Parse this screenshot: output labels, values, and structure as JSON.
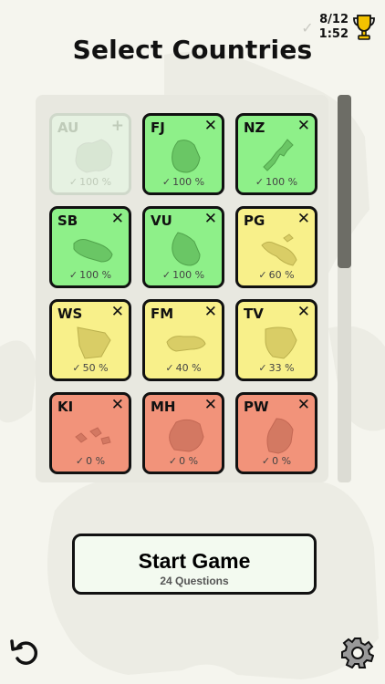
{
  "status": {
    "progress": "8/12",
    "timer": "1:52"
  },
  "title": "Select Countries",
  "colors": {
    "green": "#8ef089",
    "yellow": "#f8f08a",
    "red": "#f2937a",
    "disabled": "#e6f2e2"
  },
  "tiles": [
    {
      "code": "AU",
      "percent": "100 %",
      "button": "+",
      "state": "disabled"
    },
    {
      "code": "FJ",
      "percent": "100 %",
      "button": "✕",
      "state": "green"
    },
    {
      "code": "NZ",
      "percent": "100 %",
      "button": "✕",
      "state": "green"
    },
    {
      "code": "SB",
      "percent": "100 %",
      "button": "✕",
      "state": "green"
    },
    {
      "code": "VU",
      "percent": "100 %",
      "button": "✕",
      "state": "green"
    },
    {
      "code": "PG",
      "percent": "60 %",
      "button": "✕",
      "state": "yellow"
    },
    {
      "code": "WS",
      "percent": "50 %",
      "button": "✕",
      "state": "yellow"
    },
    {
      "code": "FM",
      "percent": "40 %",
      "button": "✕",
      "state": "yellow"
    },
    {
      "code": "TV",
      "percent": "33 %",
      "button": "✕",
      "state": "yellow"
    },
    {
      "code": "KI",
      "percent": "0 %",
      "button": "✕",
      "state": "red"
    },
    {
      "code": "MH",
      "percent": "0 %",
      "button": "✕",
      "state": "red"
    },
    {
      "code": "PW",
      "percent": "0 %",
      "button": "✕",
      "state": "red"
    }
  ],
  "start": {
    "label": "Start Game",
    "sub": "24 Questions"
  },
  "icons": {
    "undo": "undo-icon",
    "settings": "gear-icon",
    "trophy": "trophy-icon",
    "check": "check-icon"
  }
}
